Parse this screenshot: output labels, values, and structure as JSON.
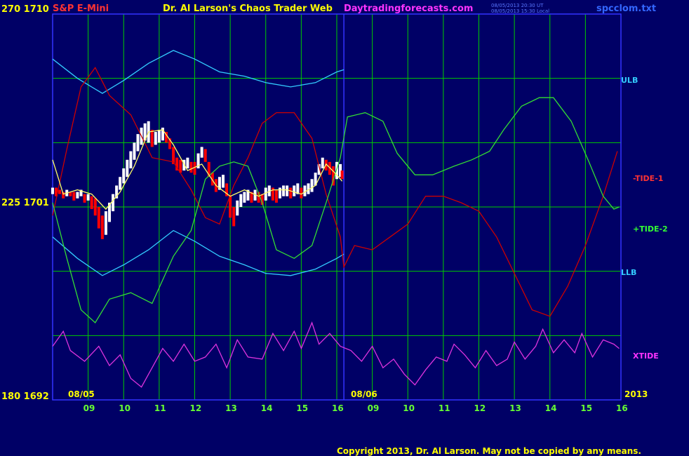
{
  "header": {
    "instrument": "S&P E-Mini",
    "title": "Dr. Al Larson's Chaos Trader Web",
    "site": "Daytradingforecasts.com",
    "timestamp_ut": "08/05/2013 20:30 UT",
    "timestamp_local": "08/05/2013 15:30 Local",
    "filename": "spcclom.txt"
  },
  "y_labels": {
    "top": "270  1710",
    "mid": "225  1701",
    "bottom": "180  1692"
  },
  "right_labels": {
    "ulb": "ULB",
    "tide1": "-TIDE-1",
    "tide2": "+TIDE-2",
    "llb": "LLB",
    "xtide": "XTIDE"
  },
  "dates": {
    "day1": "08/05",
    "day2": "08/06",
    "year": "2013"
  },
  "copyright": "Copyright 2013, Dr. Al Larson. May not be copied by any means.",
  "colors": {
    "background": "#000066",
    "grid": "#00cc00",
    "divider": "#3333ff",
    "price_up": "#ffffff",
    "price_down": "#ff0000",
    "ulb": "#33ccff",
    "tide1": "#cc0000",
    "tide2": "#33dd33",
    "xtide": "#dd33dd",
    "avg": "#ffff66",
    "text_yellow": "#ffff00",
    "text_red": "#ff3333",
    "text_magenta": "#ff33ff"
  },
  "chart_data": {
    "type": "line",
    "x_hours": [
      9,
      10,
      11,
      12,
      13,
      14,
      15,
      16,
      9,
      10,
      11,
      12,
      13,
      14,
      15,
      16
    ],
    "x_labels": [
      "09",
      "10",
      "11",
      "12",
      "13",
      "14",
      "15",
      "16",
      "09",
      "10",
      "11",
      "12",
      "13",
      "14",
      "15",
      "16"
    ],
    "y_range": [
      1692,
      1710
    ],
    "series": [
      {
        "name": "ULB",
        "points": [
          [
            8.0,
            1707.9
          ],
          [
            8.7,
            1707.0
          ],
          [
            9.4,
            1706.3
          ],
          [
            10.0,
            1706.9
          ],
          [
            10.7,
            1707.7
          ],
          [
            11.4,
            1708.3
          ],
          [
            12.0,
            1707.9
          ],
          [
            12.7,
            1707.3
          ],
          [
            13.4,
            1707.1
          ],
          [
            14.0,
            1706.8
          ],
          [
            14.7,
            1706.6
          ],
          [
            15.4,
            1706.8
          ],
          [
            16.0,
            1707.3
          ],
          [
            16.2,
            1707.4
          ]
        ]
      },
      {
        "name": "LLB",
        "points": [
          [
            8.0,
            1699.6
          ],
          [
            8.7,
            1698.6
          ],
          [
            9.4,
            1697.8
          ],
          [
            10.0,
            1698.3
          ],
          [
            10.7,
            1699.0
          ],
          [
            11.4,
            1699.9
          ],
          [
            12.0,
            1699.4
          ],
          [
            12.7,
            1698.7
          ],
          [
            13.4,
            1698.3
          ],
          [
            14.0,
            1697.9
          ],
          [
            14.7,
            1697.8
          ],
          [
            15.4,
            1698.1
          ],
          [
            16.0,
            1698.6
          ],
          [
            16.2,
            1698.8
          ]
        ]
      },
      {
        "name": "-TIDE-1",
        "points": [
          [
            8.0,
            1700.6
          ],
          [
            8.4,
            1703.7
          ],
          [
            8.8,
            1706.6
          ],
          [
            9.2,
            1707.5
          ],
          [
            9.6,
            1706.2
          ],
          [
            10.2,
            1705.3
          ],
          [
            10.8,
            1703.3
          ],
          [
            11.4,
            1703.1
          ],
          [
            11.9,
            1701.8
          ],
          [
            12.3,
            1700.5
          ],
          [
            12.7,
            1700.2
          ],
          [
            13.1,
            1702.0
          ],
          [
            13.5,
            1703.3
          ],
          [
            13.9,
            1704.9
          ],
          [
            14.3,
            1705.4
          ],
          [
            14.8,
            1705.4
          ],
          [
            15.3,
            1704.2
          ],
          [
            15.7,
            1701.6
          ],
          [
            16.1,
            1699.6
          ],
          [
            16.2,
            1698.2
          ],
          [
            16.5,
            1699.2
          ],
          [
            17.0,
            1699.0
          ],
          [
            17.5,
            1699.6
          ],
          [
            18.0,
            1700.2
          ],
          [
            18.5,
            1701.5
          ],
          [
            19.0,
            1701.5
          ],
          [
            19.5,
            1701.2
          ],
          [
            20.0,
            1700.8
          ],
          [
            20.5,
            1699.6
          ],
          [
            21.0,
            1697.9
          ],
          [
            21.5,
            1696.2
          ],
          [
            22.0,
            1695.9
          ],
          [
            22.5,
            1697.3
          ],
          [
            23.0,
            1699.2
          ],
          [
            23.5,
            1701.5
          ],
          [
            23.9,
            1703.6
          ]
        ]
      },
      {
        "name": "+TIDE-2",
        "points": [
          [
            8.0,
            1701.2
          ],
          [
            8.4,
            1698.6
          ],
          [
            8.8,
            1696.2
          ],
          [
            9.2,
            1695.6
          ],
          [
            9.6,
            1696.7
          ],
          [
            10.2,
            1697.0
          ],
          [
            10.8,
            1696.5
          ],
          [
            11.4,
            1698.7
          ],
          [
            11.9,
            1699.9
          ],
          [
            12.3,
            1702.3
          ],
          [
            12.7,
            1702.9
          ],
          [
            13.1,
            1703.1
          ],
          [
            13.5,
            1702.9
          ],
          [
            13.9,
            1701.2
          ],
          [
            14.3,
            1699.0
          ],
          [
            14.8,
            1698.6
          ],
          [
            15.3,
            1699.2
          ],
          [
            15.7,
            1701.2
          ],
          [
            16.1,
            1703.3
          ],
          [
            16.3,
            1705.2
          ],
          [
            16.8,
            1705.4
          ],
          [
            17.3,
            1705.0
          ],
          [
            17.7,
            1703.5
          ],
          [
            18.2,
            1702.5
          ],
          [
            18.7,
            1702.5
          ],
          [
            19.3,
            1702.9
          ],
          [
            19.8,
            1703.2
          ],
          [
            20.3,
            1703.6
          ],
          [
            20.7,
            1704.6
          ],
          [
            21.2,
            1705.7
          ],
          [
            21.7,
            1706.1
          ],
          [
            22.1,
            1706.1
          ],
          [
            22.6,
            1705.0
          ],
          [
            23.1,
            1703.1
          ],
          [
            23.5,
            1701.5
          ],
          [
            23.8,
            1700.9
          ],
          [
            23.95,
            1701.0
          ]
        ]
      },
      {
        "name": "XTIDE",
        "points": [
          [
            8.0,
            1694.5
          ],
          [
            8.3,
            1695.2
          ],
          [
            8.5,
            1694.3
          ],
          [
            8.9,
            1693.8
          ],
          [
            9.3,
            1694.5
          ],
          [
            9.6,
            1693.6
          ],
          [
            9.9,
            1694.1
          ],
          [
            10.2,
            1693.0
          ],
          [
            10.5,
            1692.6
          ],
          [
            10.8,
            1693.5
          ],
          [
            11.1,
            1694.4
          ],
          [
            11.4,
            1693.8
          ],
          [
            11.7,
            1694.6
          ],
          [
            12.0,
            1693.8
          ],
          [
            12.3,
            1694.0
          ],
          [
            12.6,
            1694.6
          ],
          [
            12.9,
            1693.5
          ],
          [
            13.2,
            1694.8
          ],
          [
            13.5,
            1694.0
          ],
          [
            13.9,
            1693.9
          ],
          [
            14.2,
            1695.1
          ],
          [
            14.5,
            1694.3
          ],
          [
            14.8,
            1695.2
          ],
          [
            15.0,
            1694.4
          ],
          [
            15.3,
            1695.6
          ],
          [
            15.5,
            1694.6
          ],
          [
            15.8,
            1695.1
          ],
          [
            16.1,
            1694.5
          ],
          [
            16.4,
            1694.3
          ],
          [
            16.7,
            1693.8
          ],
          [
            17.0,
            1694.5
          ],
          [
            17.3,
            1693.5
          ],
          [
            17.6,
            1693.9
          ],
          [
            17.9,
            1693.2
          ],
          [
            18.2,
            1692.7
          ],
          [
            18.5,
            1693.4
          ],
          [
            18.8,
            1694.0
          ],
          [
            19.1,
            1693.8
          ],
          [
            19.3,
            1694.6
          ],
          [
            19.6,
            1694.1
          ],
          [
            19.9,
            1693.5
          ],
          [
            20.2,
            1694.3
          ],
          [
            20.5,
            1693.6
          ],
          [
            20.8,
            1693.9
          ],
          [
            21.0,
            1694.7
          ],
          [
            21.3,
            1693.9
          ],
          [
            21.6,
            1694.5
          ],
          [
            21.8,
            1695.3
          ],
          [
            22.1,
            1694.2
          ],
          [
            22.4,
            1694.8
          ],
          [
            22.7,
            1694.2
          ],
          [
            22.9,
            1695.1
          ],
          [
            23.2,
            1694.0
          ],
          [
            23.5,
            1694.8
          ],
          [
            23.8,
            1694.6
          ],
          [
            23.95,
            1694.4
          ]
        ]
      },
      {
        "name": "avg",
        "points": [
          [
            8.0,
            1703.2
          ],
          [
            8.3,
            1701.6
          ],
          [
            8.7,
            1701.8
          ],
          [
            9.1,
            1701.6
          ],
          [
            9.5,
            1700.9
          ],
          [
            9.9,
            1701.7
          ],
          [
            10.3,
            1702.9
          ],
          [
            10.7,
            1704.5
          ],
          [
            11.1,
            1704.6
          ],
          [
            11.4,
            1703.9
          ],
          [
            11.8,
            1702.7
          ],
          [
            12.2,
            1703.0
          ],
          [
            12.6,
            1702.0
          ],
          [
            13.0,
            1701.5
          ],
          [
            13.4,
            1701.8
          ],
          [
            13.8,
            1701.5
          ],
          [
            14.2,
            1701.8
          ],
          [
            14.6,
            1701.8
          ],
          [
            15.0,
            1701.6
          ],
          [
            15.4,
            1702.0
          ],
          [
            15.7,
            1703.0
          ],
          [
            16.0,
            1702.5
          ],
          [
            16.15,
            1702.2
          ]
        ]
      }
    ],
    "price_bars": [
      [
        8.0,
        1701.6,
        1701.9
      ],
      [
        8.1,
        1701.5,
        1701.9
      ],
      [
        8.2,
        1701.6,
        1701.8
      ],
      [
        8.3,
        1701.4,
        1701.7
      ],
      [
        8.4,
        1701.5,
        1701.8
      ],
      [
        8.5,
        1701.5,
        1701.7
      ],
      [
        8.6,
        1701.3,
        1701.7
      ],
      [
        8.7,
        1701.4,
        1701.7
      ],
      [
        8.8,
        1701.5,
        1701.8
      ],
      [
        8.9,
        1701.2,
        1701.6
      ],
      [
        9.0,
        1701.3,
        1701.6
      ],
      [
        9.1,
        1700.9,
        1701.5
      ],
      [
        9.2,
        1700.6,
        1701.4
      ],
      [
        9.3,
        1700.0,
        1701.0
      ],
      [
        9.4,
        1699.5,
        1700.6
      ],
      [
        9.5,
        1699.7,
        1700.8
      ],
      [
        9.6,
        1700.3,
        1701.2
      ],
      [
        9.7,
        1700.8,
        1701.6
      ],
      [
        9.8,
        1701.4,
        1702.0
      ],
      [
        9.9,
        1701.8,
        1702.4
      ],
      [
        10.0,
        1702.1,
        1702.8
      ],
      [
        10.1,
        1702.4,
        1703.2
      ],
      [
        10.2,
        1702.8,
        1703.6
      ],
      [
        10.3,
        1703.2,
        1704.0
      ],
      [
        10.4,
        1703.6,
        1704.4
      ],
      [
        10.5,
        1703.9,
        1704.7
      ],
      [
        10.6,
        1704.1,
        1704.9
      ],
      [
        10.7,
        1704.0,
        1705.0
      ],
      [
        10.8,
        1703.8,
        1704.6
      ],
      [
        10.9,
        1703.9,
        1704.5
      ],
      [
        11.0,
        1704.0,
        1704.6
      ],
      [
        11.1,
        1704.1,
        1704.7
      ],
      [
        11.2,
        1704.0,
        1704.5
      ],
      [
        11.3,
        1703.7,
        1704.2
      ],
      [
        11.4,
        1703.0,
        1703.8
      ],
      [
        11.5,
        1702.7,
        1703.3
      ],
      [
        11.6,
        1702.6,
        1703.2
      ],
      [
        11.7,
        1702.7,
        1703.2
      ],
      [
        11.8,
        1702.8,
        1703.3
      ],
      [
        11.9,
        1702.6,
        1703.1
      ],
      [
        12.0,
        1702.5,
        1703.1
      ],
      [
        12.1,
        1702.8,
        1703.5
      ],
      [
        12.2,
        1703.3,
        1703.8
      ],
      [
        12.3,
        1703.1,
        1703.7
      ],
      [
        12.4,
        1702.4,
        1703.1
      ],
      [
        12.5,
        1702.0,
        1702.6
      ],
      [
        12.6,
        1701.7,
        1702.3
      ],
      [
        12.7,
        1701.8,
        1702.4
      ],
      [
        12.8,
        1701.9,
        1702.5
      ],
      [
        12.9,
        1701.5,
        1702.1
      ],
      [
        13.0,
        1700.5,
        1701.5
      ],
      [
        13.1,
        1700.1,
        1701.0
      ],
      [
        13.2,
        1700.6,
        1701.3
      ],
      [
        13.3,
        1701.0,
        1701.6
      ],
      [
        13.4,
        1701.2,
        1701.7
      ],
      [
        13.5,
        1701.3,
        1701.8
      ],
      [
        13.6,
        1701.2,
        1701.7
      ],
      [
        13.7,
        1701.3,
        1701.8
      ],
      [
        13.8,
        1701.2,
        1701.7
      ],
      [
        13.9,
        1701.1,
        1701.6
      ],
      [
        14.0,
        1701.3,
        1701.9
      ],
      [
        14.1,
        1701.5,
        1702.0
      ],
      [
        14.2,
        1701.3,
        1701.9
      ],
      [
        14.3,
        1701.2,
        1701.8
      ],
      [
        14.4,
        1701.4,
        1701.9
      ],
      [
        14.5,
        1701.5,
        1702.0
      ],
      [
        14.6,
        1701.5,
        1702.0
      ],
      [
        14.7,
        1701.4,
        1701.9
      ],
      [
        14.8,
        1701.5,
        1702.0
      ],
      [
        14.9,
        1701.6,
        1702.1
      ],
      [
        15.0,
        1701.4,
        1701.9
      ],
      [
        15.1,
        1701.5,
        1702.0
      ],
      [
        15.2,
        1701.6,
        1702.1
      ],
      [
        15.3,
        1701.7,
        1702.3
      ],
      [
        15.4,
        1702.0,
        1702.6
      ],
      [
        15.5,
        1702.5,
        1703.0
      ],
      [
        15.6,
        1702.8,
        1703.3
      ],
      [
        15.7,
        1702.7,
        1703.2
      ],
      [
        15.8,
        1702.5,
        1703.1
      ],
      [
        15.9,
        1702.0,
        1702.9
      ],
      [
        16.0,
        1702.3,
        1703.1
      ],
      [
        16.1,
        1702.4,
        1703.0
      ],
      [
        16.15,
        1702.3,
        1702.7
      ]
    ]
  }
}
